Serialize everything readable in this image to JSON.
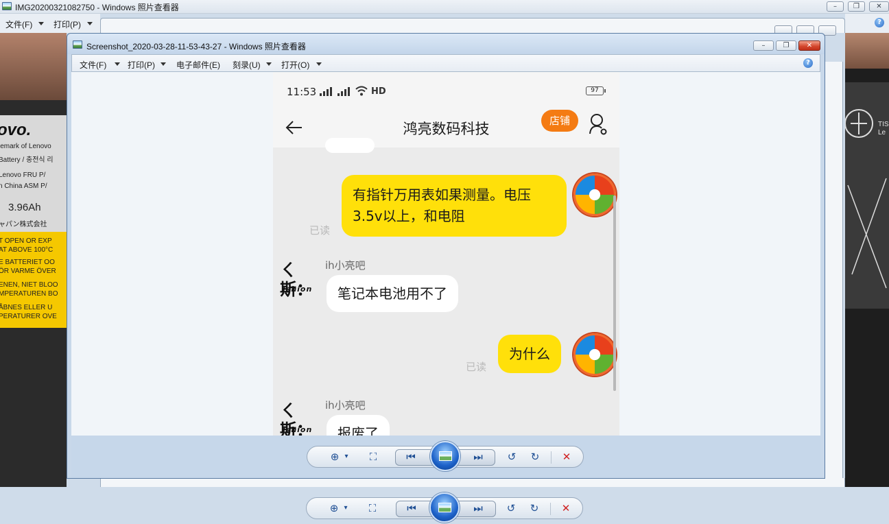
{
  "outer_window": {
    "title": "IMG20200321082750 - Windows 照片查看器",
    "menu": [
      {
        "label": "文件(F)"
      },
      {
        "label": "打印(P)"
      }
    ],
    "controls": {
      "minimize": "–",
      "maximize": "❐",
      "close": "✕"
    },
    "help": "?"
  },
  "inner_window": {
    "title": "Screenshot_2020-03-28-11-53-43-27 - Windows 照片查看器",
    "menu": [
      {
        "label": "文件(F)"
      },
      {
        "label": "打印(P)"
      },
      {
        "label": "电子邮件(E)"
      },
      {
        "label": "刻录(U)"
      },
      {
        "label": "打开(O)"
      }
    ],
    "controls": {
      "minimize": "–",
      "maximize": "❐",
      "close": "✕"
    },
    "help": "?"
  },
  "toolbar": {
    "zoom": "⊕",
    "zoom_arrow": "▾",
    "fit": "⛶",
    "prev": "⏮",
    "next": "⏭",
    "rotate_ccw": "↺",
    "rotate_cw": "↻",
    "delete": "✕"
  },
  "photo_background": {
    "left_texts": [
      "ovo.",
      "lemark of Lenovo",
      "Battery / 충전식 리",
      "Lenovo   FRU P/",
      "n China   ASM P/",
      "3.96Ah",
      "ャパン株式会社",
      "T OPEN OR EXP",
      "AT ABOVE 100°C",
      "E BATTERIET OO",
      "ÖR VARME ÖVER",
      "ENEN, NIET BLOO",
      "MPERATUREN BO",
      "ÅBNES ELLER U",
      "PERATURER OVE"
    ],
    "right_texts": [
      "TIS",
      "Le"
    ]
  },
  "phone": {
    "status": {
      "time": "11:53",
      "network": "HD",
      "battery": "97"
    },
    "header": {
      "title": "鸿亮数码科技",
      "shop_button": "店铺"
    },
    "messages": [
      {
        "side": "mine",
        "text_lines": [
          "有指针万用表如果测量。电压",
          "3.5v以上，和电阻"
        ],
        "read": "已读"
      },
      {
        "side": "theirs",
        "sender": "ih小亮吧",
        "text": "笔记本电池用不了"
      },
      {
        "side": "mine",
        "text": "为什么",
        "read": "已读"
      },
      {
        "side": "theirs",
        "sender": "ih小亮吧",
        "text": "报废了"
      }
    ],
    "shop_avatar_text": "ㄑ斯：",
    "shop_avatar_sub": "ishion"
  }
}
